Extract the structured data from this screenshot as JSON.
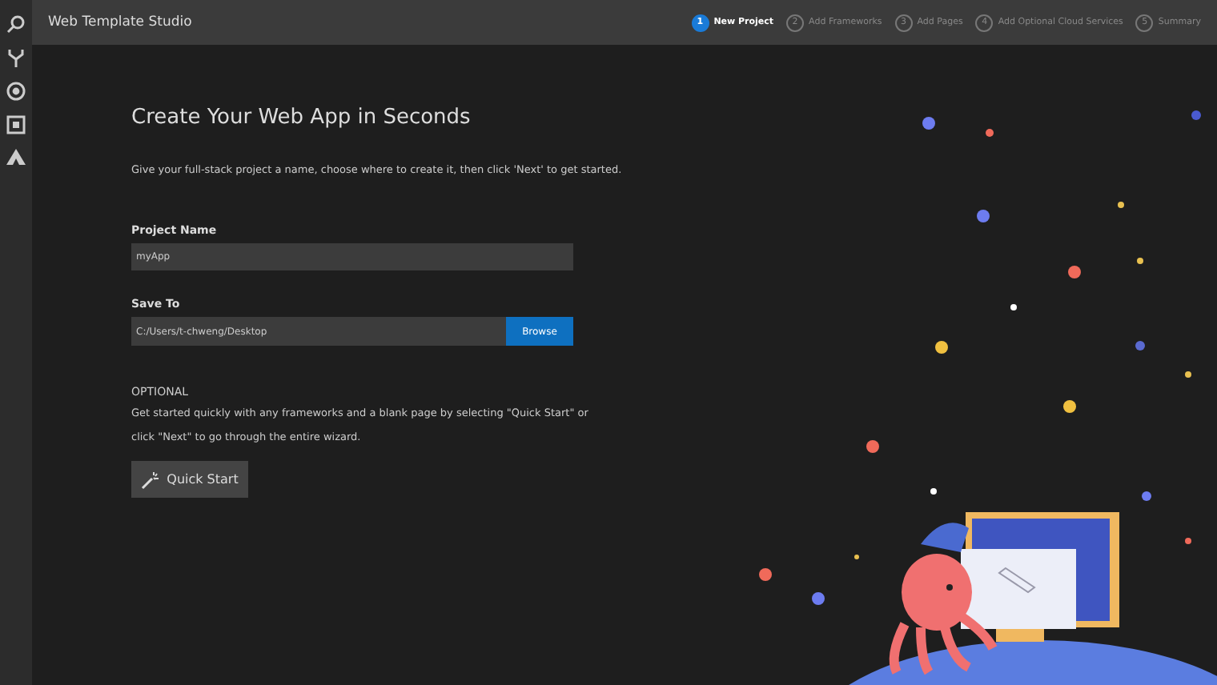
{
  "window": {
    "title": "Web Template Studio"
  },
  "steps": [
    {
      "number": "1",
      "label": "New Project",
      "selected": true
    },
    {
      "number": "2",
      "label": "Add Frameworks",
      "selected": false
    },
    {
      "number": "3",
      "label": "Add Pages",
      "selected": false
    },
    {
      "number": "4",
      "label": "Add Optional Cloud Services",
      "selected": false
    },
    {
      "number": "5",
      "label": "Summary",
      "selected": false
    }
  ],
  "heading": "Create Your Web App in Seconds",
  "intro": "Give your full-stack project a name, choose where to create it, then click 'Next' to get started.",
  "project_name": {
    "label": "Project Name",
    "value": "myApp"
  },
  "save_to": {
    "label": "Save To",
    "value": "C:/Users/t-chweng/Desktop",
    "button": "Browse"
  },
  "optional": {
    "label": "OPTIONAL",
    "text": "Get started quickly with any frameworks and a blank page by selecting \"Quick Start\" or click \"Next\" to go through the entire wizard.",
    "button": "Quick Start"
  }
}
